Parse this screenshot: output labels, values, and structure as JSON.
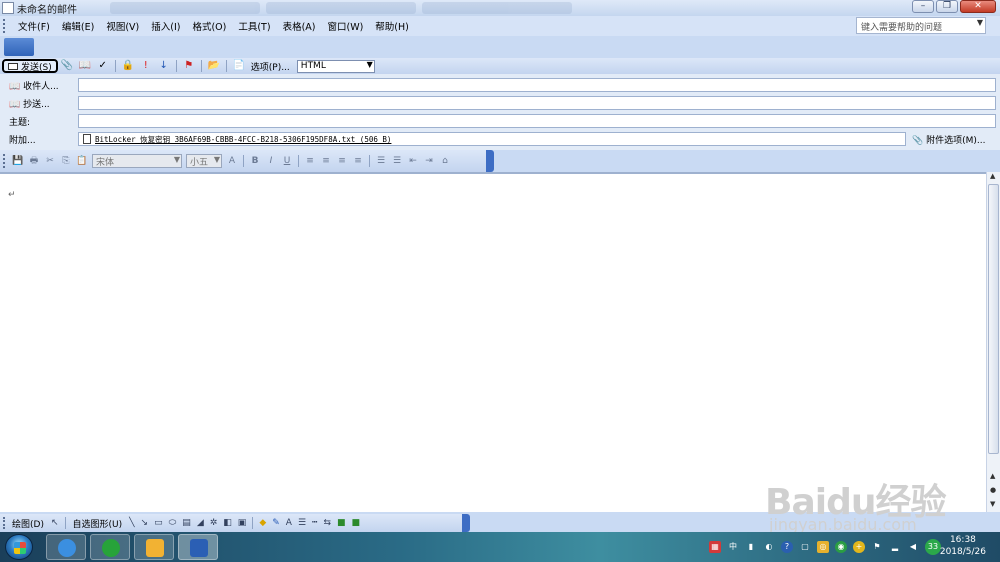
{
  "window": {
    "title": "未命名的邮件",
    "buttons": {
      "minimize": "–",
      "restore": "❐",
      "close": "✕"
    }
  },
  "menubar": {
    "items": [
      "文件(F)",
      "编辑(E)",
      "视图(V)",
      "插入(I)",
      "格式(O)",
      "工具(T)",
      "表格(A)",
      "窗口(W)",
      "帮助(H)"
    ],
    "help_placeholder": "键入需要帮助的问题"
  },
  "envelope_toolbar": {
    "send_label": "发送(S)",
    "options_label": "选项(P)...",
    "format_value": "HTML"
  },
  "fields": {
    "to_label": "收件人...",
    "cc_label": "抄送...",
    "subject_label": "主题:",
    "attach_label": "附加...",
    "attachment_file": "BitLocker 恢复密钥 3B6AF69B-CBBB-4FCC-B218-5306F195DF8A.txt (506 B)",
    "attach_options_label": "附件选项(M)..."
  },
  "format_toolbar": {
    "font_name": "宋体",
    "font_size": "小五",
    "bold": "B",
    "italic": "I",
    "underline": "U"
  },
  "document": {
    "paragraph_mark": "↵"
  },
  "drawing_toolbar": {
    "draw_label": "绘图(D)",
    "autoshapes_label": "自选图形(U)"
  },
  "taskbar": {
    "apps": [
      "ie",
      "browser",
      "outlook",
      "word"
    ],
    "tray_lang": "中",
    "tray_badge": "33",
    "time": "16:38",
    "date": "2018/5/26"
  },
  "watermark": {
    "brand": "Baidu经验",
    "url": "jingyan.baidu.com"
  },
  "colors": {
    "chrome": "#c9daf3",
    "taskbar": "#2a6b86",
    "close": "#c33b26"
  }
}
